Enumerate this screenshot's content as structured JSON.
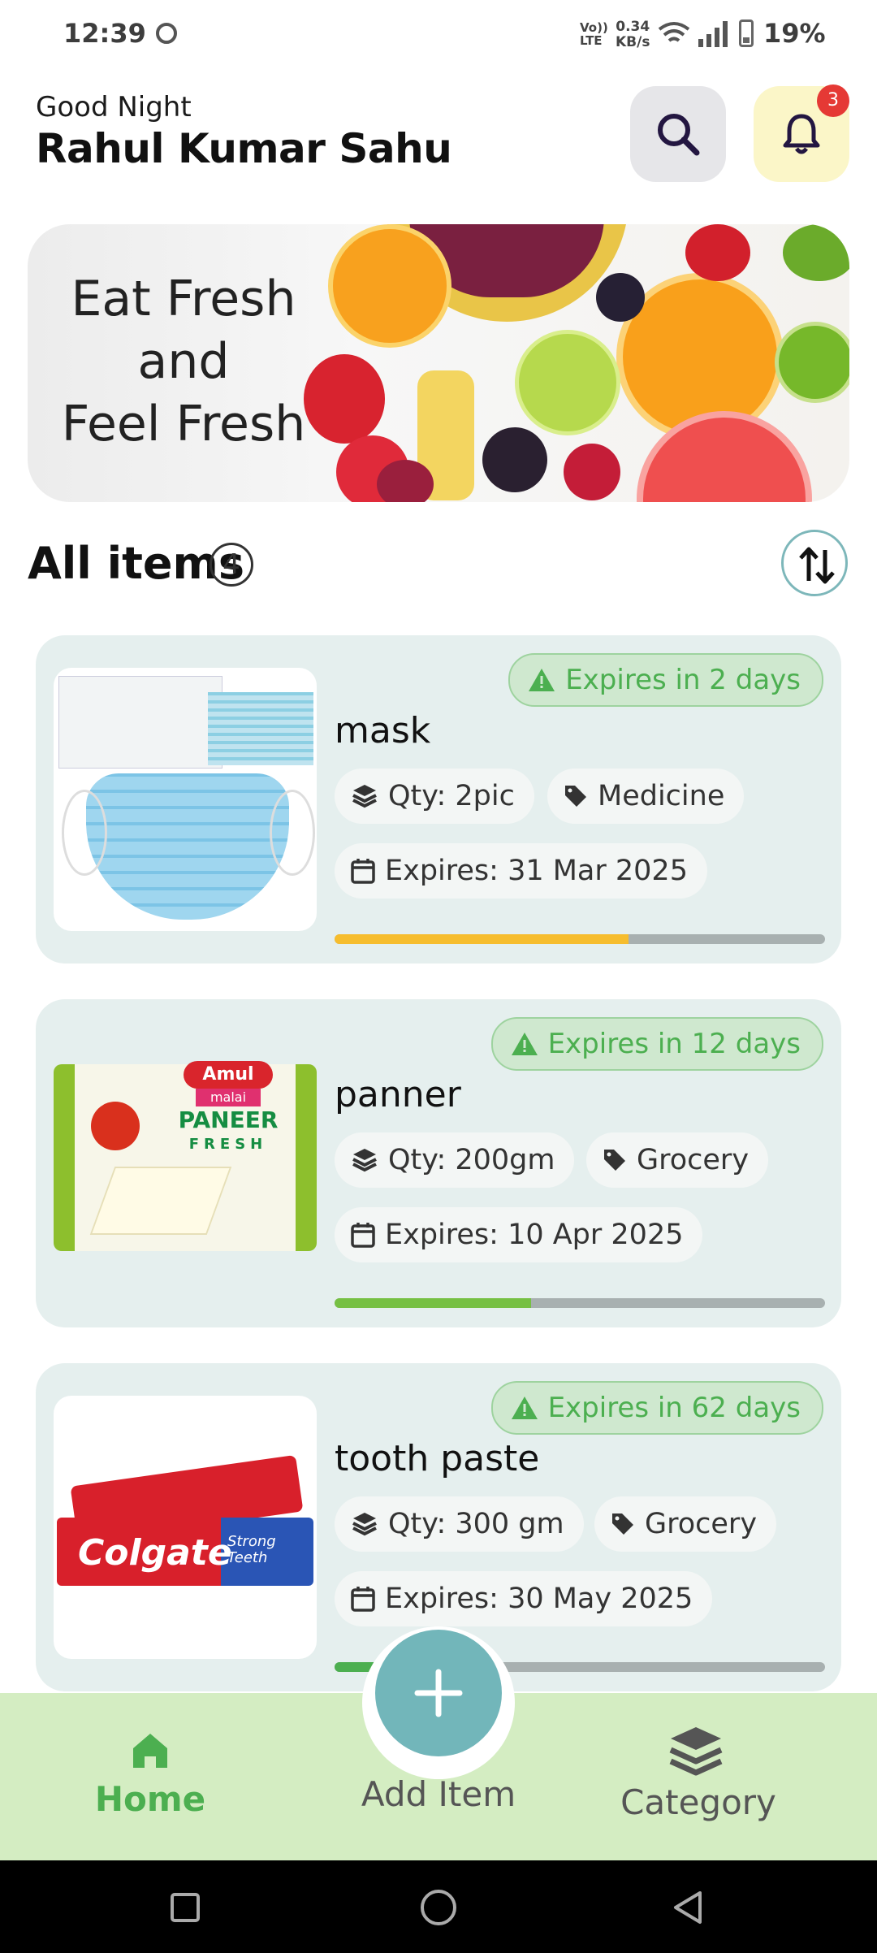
{
  "status_bar": {
    "time": "12:39",
    "network_top": "Vo))",
    "network_bottom": "LTE",
    "speed_value": "0.34",
    "speed_unit": "KB/s",
    "battery": "19%"
  },
  "header": {
    "greeting": "Good Night",
    "user_name": "Rahul Kumar Sahu",
    "notification_count": "3"
  },
  "banner": {
    "line1": "Eat Fresh",
    "line2": "and",
    "line3": "Feel Fresh"
  },
  "items_section": {
    "title": "All items",
    "count": "4"
  },
  "items": [
    {
      "name": "mask",
      "expires_in": "Expires in 2 days",
      "qty": "Qty: 2pic",
      "category": "Medicine",
      "expiry_date": "Expires: 31 Mar 2025",
      "progress": 0.6,
      "progress_color": "#f6bd2e"
    },
    {
      "name": "panner",
      "expires_in": "Expires in 12 days",
      "qty": "Qty: 200gm",
      "category": "Grocery",
      "expiry_date": "Expires: 10 Apr 2025",
      "progress": 0.4,
      "progress_color": "#76c043",
      "thumb_brand": "Amul",
      "thumb_sub": "malai",
      "thumb_title": "PANEER",
      "thumb_fresh": "FRESH"
    },
    {
      "name": "tooth paste",
      "expires_in": "Expires in 62 days",
      "qty": "Qty: 300 gm",
      "category": "Grocery",
      "expiry_date": "Expires: 30 May 2025",
      "progress": 0.08,
      "progress_color": "#4caf50",
      "thumb_brand": "Colgate",
      "thumb_tag": "Strong Teeth"
    }
  ],
  "bottom_nav": {
    "home": "Home",
    "add": "Add Item",
    "category": "Category"
  },
  "colors": {
    "accent": "#72b6ba",
    "success": "#4caf50",
    "card_bg": "#e5efee",
    "nav_bg": "#d4edc2"
  }
}
